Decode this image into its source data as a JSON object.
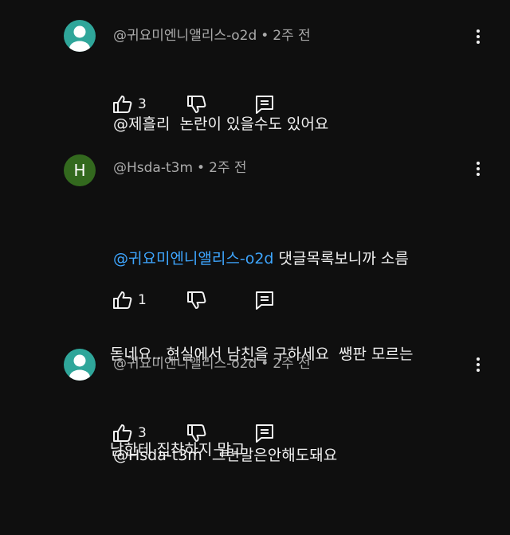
{
  "comments": [
    {
      "author": "@귀요미엔니앨리스-o2d",
      "separator": "•",
      "time": "2주 전",
      "avatar_type": "default",
      "avatar_letter": "",
      "mention": "",
      "line1": "@제흘리  논란이 있을수도 있어요",
      "line2": "",
      "line3": "",
      "likes": "3"
    },
    {
      "author": "@Hsda-t3m",
      "separator": "•",
      "time": "2주 전",
      "avatar_type": "letter",
      "avatar_letter": "H",
      "mention": "@귀요미엔니앨리스-o2d",
      "line1": " 댓글목록보니까 소름",
      "line2": "돋네요.. 현실에서 남친을 구하세요  쌩판 모르는",
      "line3": "남한테 집착하지 말고",
      "likes": "1"
    },
    {
      "author": "@귀요미엔니앨리스-o2d",
      "separator": "•",
      "time": "2주 전",
      "avatar_type": "default",
      "avatar_letter": "",
      "mention": "",
      "line1": "@Hsda-t3m  그런말은안해도돼요",
      "line2": "",
      "line3": "",
      "likes": "3"
    }
  ],
  "icons": {
    "like": "thumb-up-icon",
    "dislike": "thumb-down-icon",
    "reply": "reply-icon",
    "more": "more-vertical-icon",
    "avatar": "default-avatar-icon"
  },
  "colors": {
    "background": "#0f0f0f",
    "text": "#f1f1f1",
    "meta": "#aaaaaa",
    "mention": "#3ea6ff",
    "default_avatar": "#2fa69a",
    "letter_avatar": "#33691e"
  }
}
